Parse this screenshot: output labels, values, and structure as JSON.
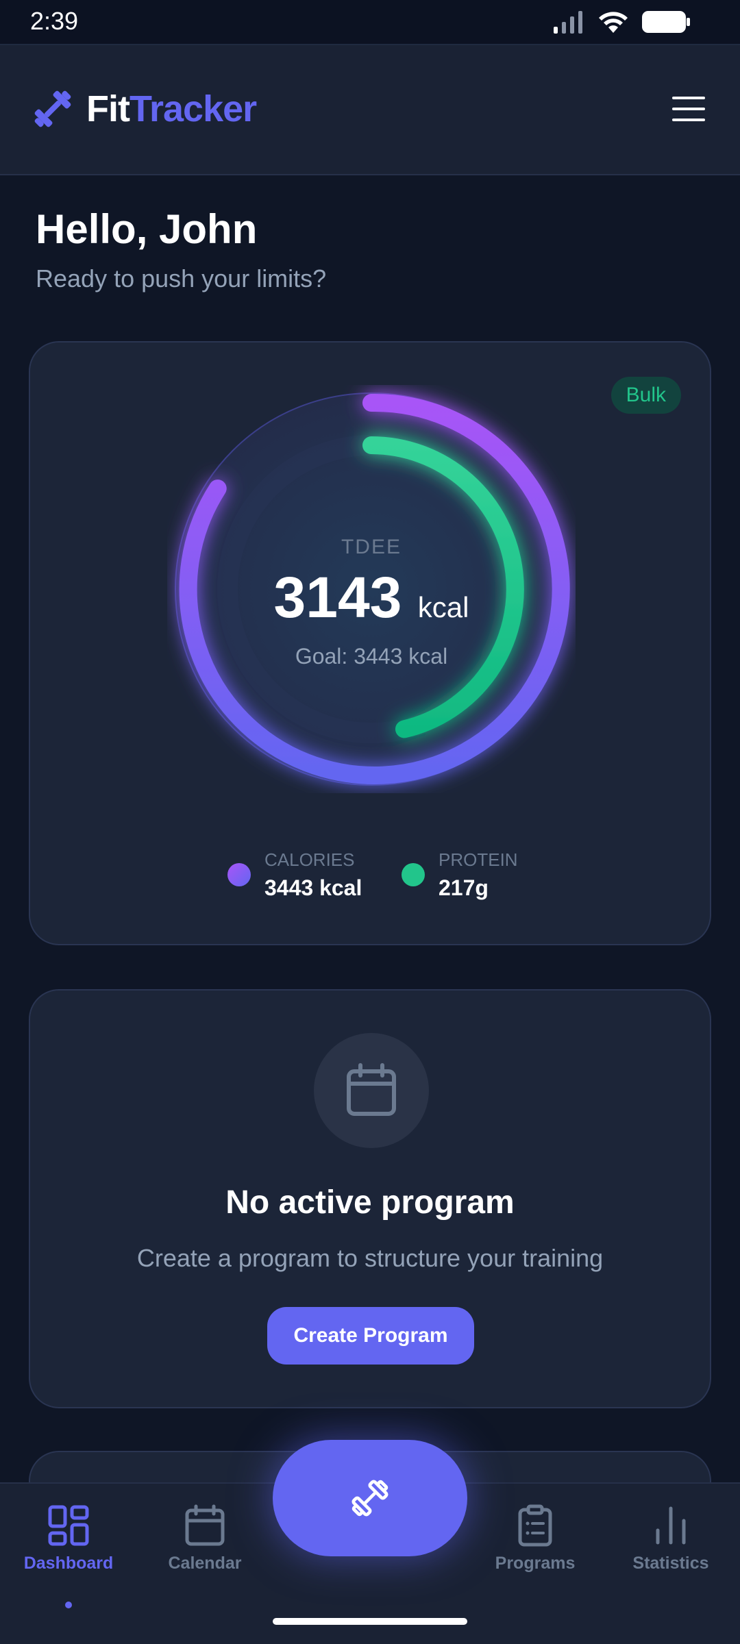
{
  "status_bar": {
    "time": "2:39"
  },
  "header": {
    "brand_part1": "Fit",
    "brand_part2": "Tracker"
  },
  "greeting": {
    "title": "Hello, John",
    "subtitle": "Ready to push your limits?"
  },
  "tdee_card": {
    "badge": "Bulk",
    "label": "TDEE",
    "value": "3143",
    "unit": "kcal",
    "goal": "Goal: 3443 kcal",
    "colors": {
      "calories": "#8b5cf6",
      "protein": "#22c58b",
      "accent": "#6366f1"
    },
    "legend": [
      {
        "label": "CALORIES",
        "value": "3443 kcal"
      },
      {
        "label": "PROTEIN",
        "value": "217g"
      }
    ]
  },
  "program_card": {
    "title": "No active program",
    "subtitle": "Create a program to structure your training",
    "button": "Create Program"
  },
  "bottom_nav": {
    "items": [
      {
        "label": "Dashboard",
        "icon": "dashboard-icon",
        "active": true
      },
      {
        "label": "Calendar",
        "icon": "calendar-icon",
        "active": false
      },
      {
        "label": "Programs",
        "icon": "clipboard-icon",
        "active": false
      },
      {
        "label": "Statistics",
        "icon": "bar-chart-icon",
        "active": false
      }
    ],
    "fab_icon": "dumbbell-icon"
  }
}
